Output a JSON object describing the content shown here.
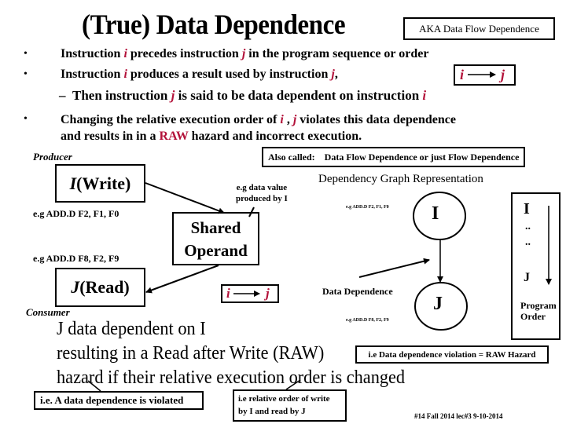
{
  "title": "(True) Data Dependence",
  "aka_box": "AKA Data Flow Dependence",
  "bullets": [
    {
      "pre": "Instruction ",
      "v1": "i",
      "mid": " precedes instruction ",
      "v2": "j",
      "post": " in the program sequence or order"
    },
    {
      "pre": "Instruction  ",
      "v1": "i",
      "mid": " produces a result used by instruction ",
      "v2": "j",
      "post": ","
    },
    {
      "dash": "–",
      "pre": "Then instruction ",
      "v1": "j",
      "mid": " is said to be data dependent on instruction  ",
      "v2": "i",
      "post": ""
    },
    {
      "pre": "Changing the relative execution order of  ",
      "v1": "i",
      "mid": " , ",
      "v2": "j",
      "post": " violates this data dependence",
      "line2_pre": "and results in in a  ",
      "line2_red": "RAW",
      "line2_post": " hazard and incorrect execution."
    }
  ],
  "arrow_notation": {
    "from": "i",
    "to": "j"
  },
  "producer_label": "Producer",
  "consumer_label": "Consumer",
  "write_box": {
    "letter": "I",
    "text": " (Write)"
  },
  "read_box": {
    "letter": "J",
    "text": " (Read)"
  },
  "example_producer": "e.g  ADD.D  F2, F1, F0",
  "example_consumer": "e.g  ADD.D  F8, F2, F9",
  "shared_operand": {
    "line1": "Shared",
    "line2": "Operand"
  },
  "data_value_note": {
    "line1": "e.g data value",
    "line2": "produced by I"
  },
  "also_called": {
    "label": "Also called:",
    "text": "Data Flow Dependence or  just Flow Dependence"
  },
  "graph": {
    "title": "Dependency Graph Representation",
    "node_i": "I",
    "node_j": "J",
    "example_i": "e.g  ADD.D  F2, F1, F0",
    "example_j": "e.g  ADD.D  F8, F2, F9",
    "edge_label": "Data Dependence"
  },
  "program_order": {
    "top": "I",
    "dots1": "..",
    "dots2": "..",
    "bottom": "J",
    "label1": "Program",
    "label2": "Order"
  },
  "summary": [
    "J data dependent on I",
    "resulting in a Read after Write  (RAW)",
    "hazard if their relative execution order is changed"
  ],
  "raw_note": "i.e Data dependence violation = RAW Hazard",
  "note_violated": "i.e.  A data dependence is violated",
  "note_order": {
    "line1": "i.e relative order of write",
    "line2": "by I and read by J"
  },
  "footer": "#14  Fall 2014 lec#3   9-10-2014",
  "colors": {
    "accent": "#b3123a",
    "ink": "#000000",
    "background": "#ffffff"
  }
}
